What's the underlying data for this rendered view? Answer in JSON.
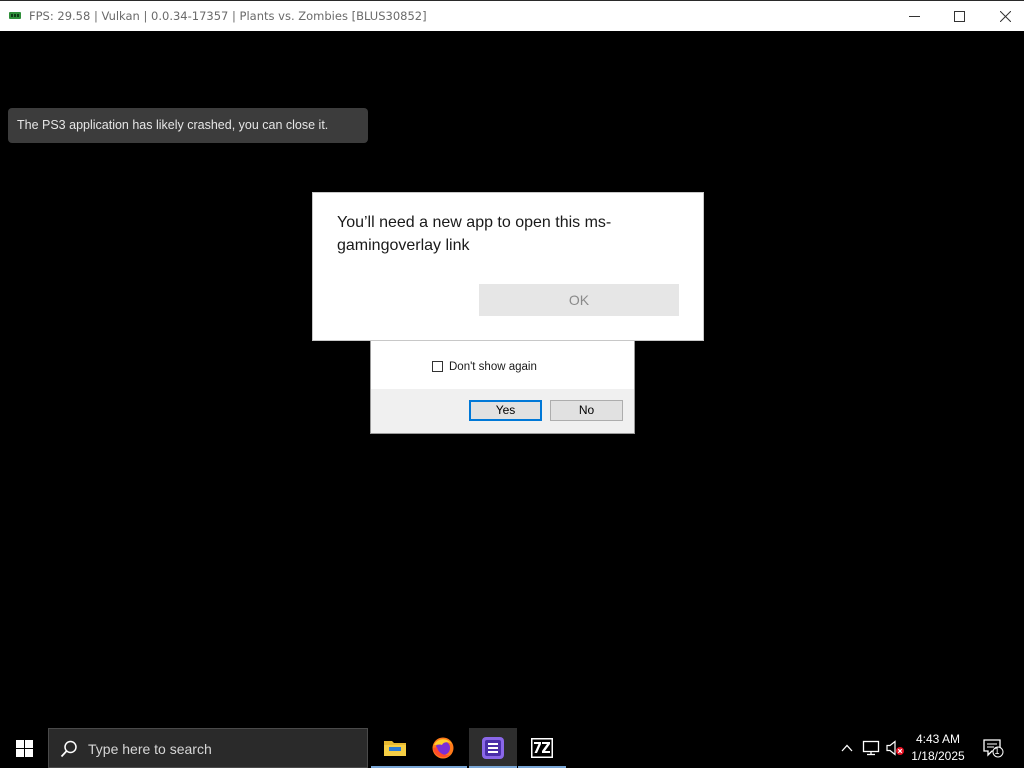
{
  "window": {
    "title": "FPS: 29.58 | Vulkan | 0.0.34-17357 | Plants vs. Zombies [BLUS30852]",
    "accent": "#0078d7"
  },
  "toast": {
    "text": "The PS3 application has likely crashed, you can close it."
  },
  "app_dialog": {
    "message": "You’ll need a new app to open this ms-gamingoverlay link",
    "ok_label": "OK"
  },
  "confirm_dialog": {
    "checkbox_label": "Don't show again",
    "checkbox_checked": false,
    "yes_label": "Yes",
    "no_label": "No"
  },
  "taskbar": {
    "search_placeholder": "Type here to search",
    "apps": [
      {
        "name": "file-explorer-icon",
        "active": false
      },
      {
        "name": "firefox-icon",
        "active": false
      },
      {
        "name": "rpcs3-icon",
        "active": true
      },
      {
        "name": "7zip-icon",
        "active": false
      }
    ],
    "tray": {
      "time": "4:43 AM",
      "date": "1/18/2025",
      "notification_count": "1"
    }
  }
}
